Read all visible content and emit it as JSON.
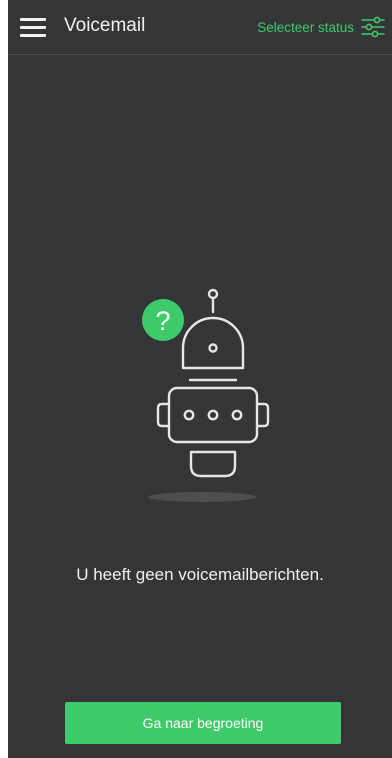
{
  "header": {
    "title": "Voicemail",
    "status_label": "Selecteer status",
    "menu_icon": "hamburger-menu-icon",
    "status_icon": "sliders-icon"
  },
  "empty_state": {
    "illustration": "robot-question-icon",
    "question_badge": "?",
    "message": "U heeft geen voicemailberichten."
  },
  "cta": {
    "label": "Ga naar begroeting"
  },
  "colors": {
    "background": "#333537",
    "accent": "#3fca6c",
    "text": "#f2f2f2",
    "illustration_stroke": "#e6e6e6",
    "shadow": "#4c4e50"
  }
}
